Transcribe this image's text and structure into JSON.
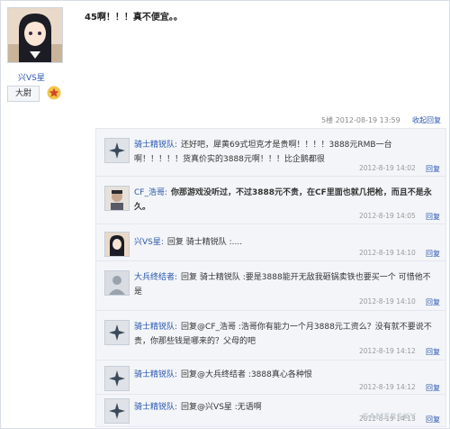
{
  "author": {
    "name": "兴VS星",
    "rank": "大尉",
    "avatar_icon": "anime-girl-avatar",
    "badge_icon": "rank-star-badge"
  },
  "post": {
    "text": "45啊！！！真不便宜。。",
    "floor": "5楼",
    "time": "2012-08-19 13:59",
    "reply_label": "收起回复"
  },
  "comments": [
    {
      "avatar": "knight-cross-avatar",
      "name": "骑士精锐队:",
      "text": "还好吧，犀黄69式坦克才是贵啊！！！！3888元RMB一台啊！！！！！货真价实的3888元啊！！！比企鹅都很",
      "time": "2012-8-19 14:02",
      "reply": "回复"
    },
    {
      "avatar": "cf-player-avatar",
      "name": "CF_浩哥:",
      "text": "你那游戏没听过，不过3888元不贵，在CF里面也就几把枪，而且不是永久。",
      "time": "2012-8-19 14:05",
      "reply": "回复"
    },
    {
      "avatar": "anime-girl-avatar",
      "name": "兴VS星:",
      "text": "回复 骑士精锐队 :....",
      "time": "2012-8-19 14:10",
      "reply": "回复"
    },
    {
      "avatar": "default-user-avatar",
      "name": "大兵终结者:",
      "text": "回复 骑士精锐队 :要是3888能开无敌我砸锅卖铁也要买一个 可惜他不是",
      "time": "2012-8-19 14:10",
      "reply": "回复"
    },
    {
      "avatar": "knight-cross-avatar",
      "name": "骑士精锐队:",
      "text": "回复@CF_浩哥 :浩哥你有能力一个月3888元工资么？没有就不要说不贵，你那些钱是哪来的？父母的吧",
      "time": "2012-8-19 14:12",
      "reply": "回复"
    },
    {
      "avatar": "knight-cross-avatar",
      "name": "骑士精锐队:",
      "text": "回复@大兵终结者 :3888真心各种恨",
      "time": "2012-8-19 14:12",
      "reply": "回复"
    },
    {
      "avatar": "knight-cross-avatar",
      "name": "骑士精锐队:",
      "text": "回复@兴VS星 :无语啊",
      "time": "2012-8-19 14:13",
      "reply": "回复"
    }
  ],
  "watermark": "GAMERSKY"
}
